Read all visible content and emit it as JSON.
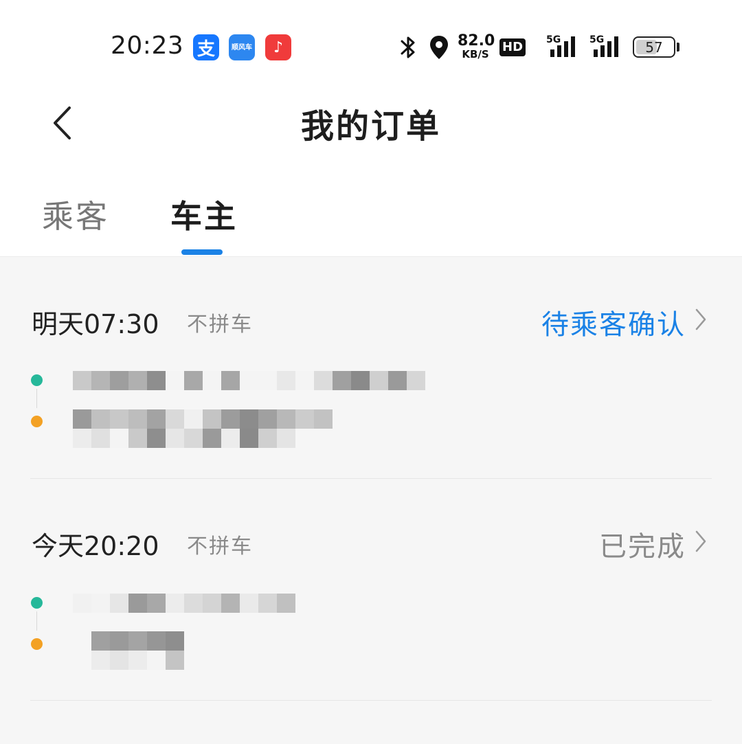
{
  "status_bar": {
    "time": "20:23",
    "apps": [
      {
        "name": "alipay-icon",
        "glyph": "支",
        "color": "#1677ff"
      },
      {
        "name": "ride-app-icon",
        "glyph": "顺风车",
        "color": "#2d87f0"
      },
      {
        "name": "music-app-icon",
        "glyph": "♪",
        "color": "#f03b3b"
      }
    ],
    "net_speed": "82.0",
    "net_speed_unit": "KB/S",
    "hd": "HD",
    "signal_label_1": "5G",
    "signal_label_2": "5G",
    "battery": "57",
    "battery_level_percent": 57
  },
  "header": {
    "title": "我的订单",
    "back_icon": "chevron-left-icon"
  },
  "tabs": {
    "items": [
      {
        "label": "乘客",
        "active": false
      },
      {
        "label": "车主",
        "active": true
      }
    ],
    "accent_color": "#1b82e6"
  },
  "orders": [
    {
      "time": "明天07:30",
      "type": "不拼车",
      "status": "待乘客确认",
      "status_color": "#1b82e6"
    },
    {
      "time": "今天20:20",
      "type": "不拼车",
      "status": "已完成",
      "status_color": "#8a8a8a"
    }
  ],
  "colors": {
    "start_dot": "#26b89a",
    "end_dot": "#f3a124",
    "background": "#f6f6f6"
  }
}
